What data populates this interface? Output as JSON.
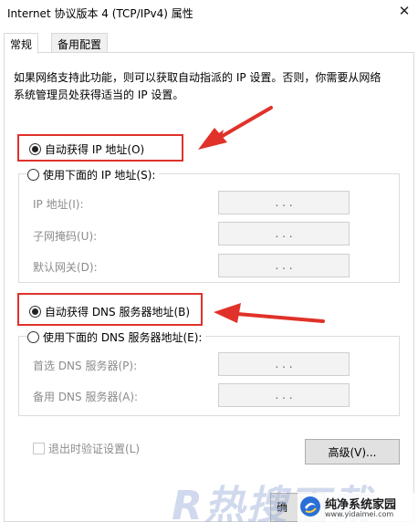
{
  "window": {
    "title": "Internet 协议版本 4 (TCP/IPv4) 属性",
    "close_glyph": "✕"
  },
  "tabs": [
    {
      "label": "常规",
      "active": true
    },
    {
      "label": "备用配置",
      "active": false
    }
  ],
  "description": "如果网络支持此功能，则可以获取自动指派的 IP 设置。否则，你需要从网络系统管理员处获得适当的 IP 设置。",
  "ip_section": {
    "auto_label": "自动获得 IP 地址(O)",
    "auto_selected": true,
    "manual_label": "使用下面的 IP 地址(S):",
    "manual_selected": false,
    "fields": [
      {
        "label": "IP 地址(I):",
        "value": ".     .     ."
      },
      {
        "label": "子网掩码(U):",
        "value": ".     .     ."
      },
      {
        "label": "默认网关(D):",
        "value": ".     .     ."
      }
    ]
  },
  "dns_section": {
    "auto_label": "自动获得 DNS 服务器地址(B)",
    "auto_selected": true,
    "manual_label": "使用下面的 DNS 服务器地址(E):",
    "manual_selected": false,
    "fields": [
      {
        "label": "首选 DNS 服务器(P):",
        "value": ".     .     ."
      },
      {
        "label": "备用 DNS 服务器(A):",
        "value": ".     .     ."
      }
    ]
  },
  "validate_on_exit": {
    "label": "退出时验证设置(L)",
    "checked": false
  },
  "buttons": {
    "advanced": "高级(V)...",
    "ok_partial": "确"
  },
  "watermarks": {
    "left_text": "R热搜下载",
    "brand_name": "纯净系统家园",
    "brand_url": "www.yidaimei.com"
  },
  "colors": {
    "annotation_red": "#e0322a",
    "disabled_text": "#8c8c8c",
    "brand_blue": "#2a6fd6"
  }
}
